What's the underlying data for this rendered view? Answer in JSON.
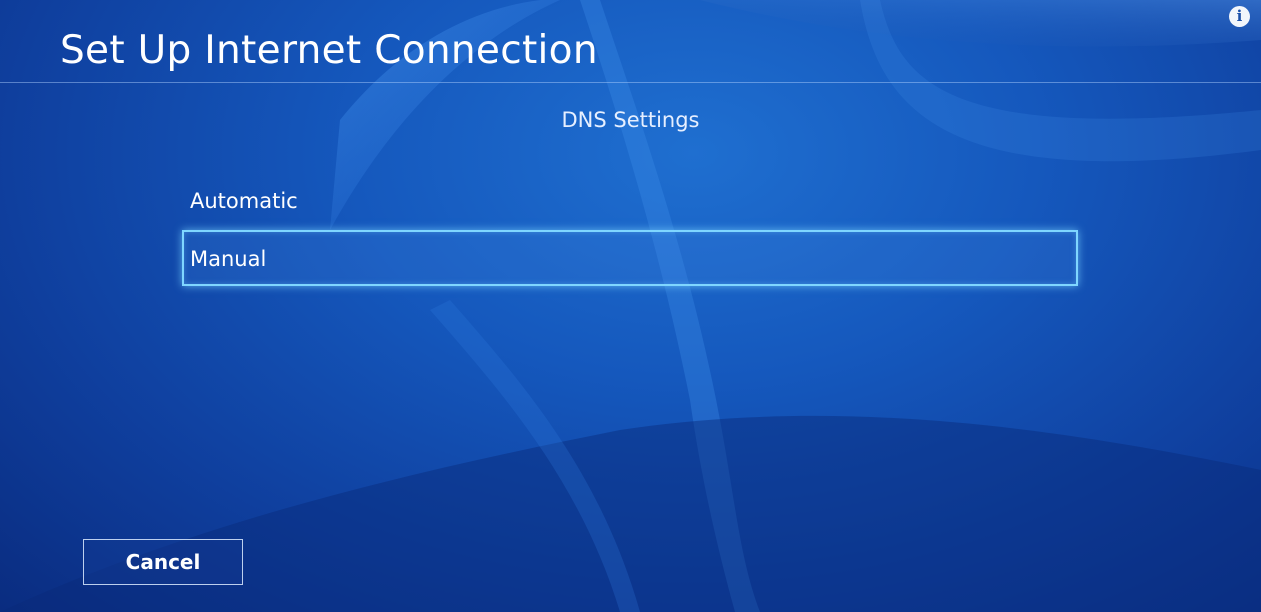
{
  "header": {
    "title": "Set Up Internet Connection",
    "info_icon": "info-icon",
    "info_glyph": "i"
  },
  "dns": {
    "heading": "DNS Settings",
    "options": [
      {
        "label": "Automatic",
        "selected": false
      },
      {
        "label": "Manual",
        "selected": true
      }
    ]
  },
  "footer": {
    "cancel_label": "Cancel"
  },
  "colors": {
    "background": "#1558bd",
    "focus_border": "#7fd6ff",
    "text": "#ffffff"
  }
}
